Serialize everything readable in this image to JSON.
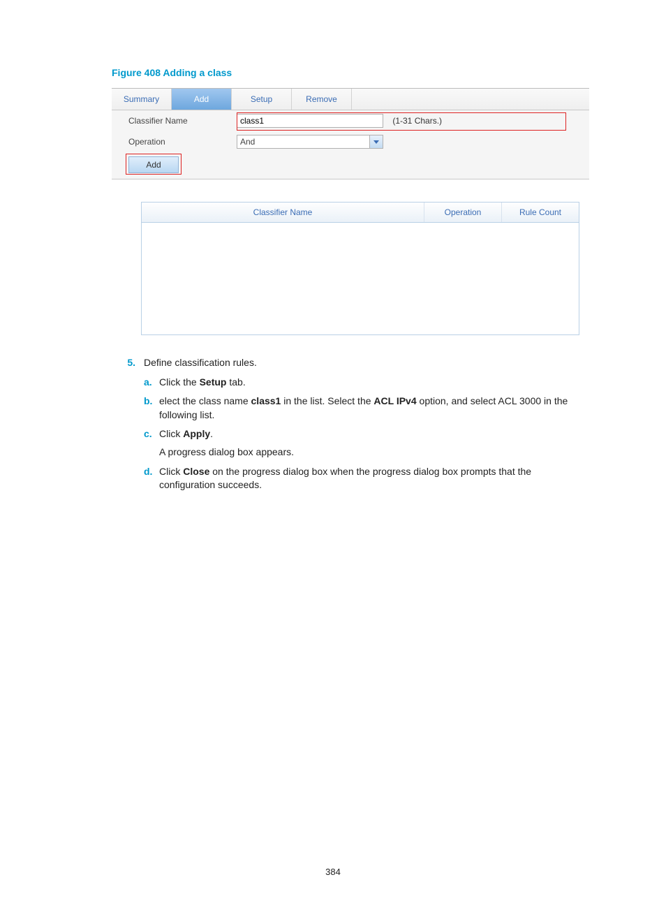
{
  "figure_title": "Figure 408 Adding a class",
  "tabs": {
    "summary": "Summary",
    "add": "Add",
    "setup": "Setup",
    "remove": "Remove"
  },
  "form": {
    "classifier_label": "Classifier Name",
    "classifier_value": "class1",
    "chars_hint": "(1-31 Chars.)",
    "operation_label": "Operation",
    "operation_value": "And",
    "add_button": "Add"
  },
  "table": {
    "col1": "Classifier Name",
    "col2": "Operation",
    "col3": "Rule Count"
  },
  "step_num": "5.",
  "step_text": "Define classification rules.",
  "subs": {
    "a": {
      "letter": "a.",
      "pre": "Click the ",
      "bold": "Setup",
      "post": " tab."
    },
    "b": {
      "letter": "b.",
      "pre": "elect the class name ",
      "bold1": "class1",
      "mid": " in the list. Select the ",
      "bold2": "ACL IPv4",
      "post": " option, and select ACL 3000 in the following list."
    },
    "c": {
      "letter": "c.",
      "pre": "Click ",
      "bold": "Apply",
      "post": ".",
      "cont": "A progress dialog box appears."
    },
    "d": {
      "letter": "d.",
      "pre": "Click ",
      "bold": "Close",
      "post": " on the progress dialog box when the progress dialog box prompts that the configuration succeeds."
    }
  },
  "page_number": "384"
}
